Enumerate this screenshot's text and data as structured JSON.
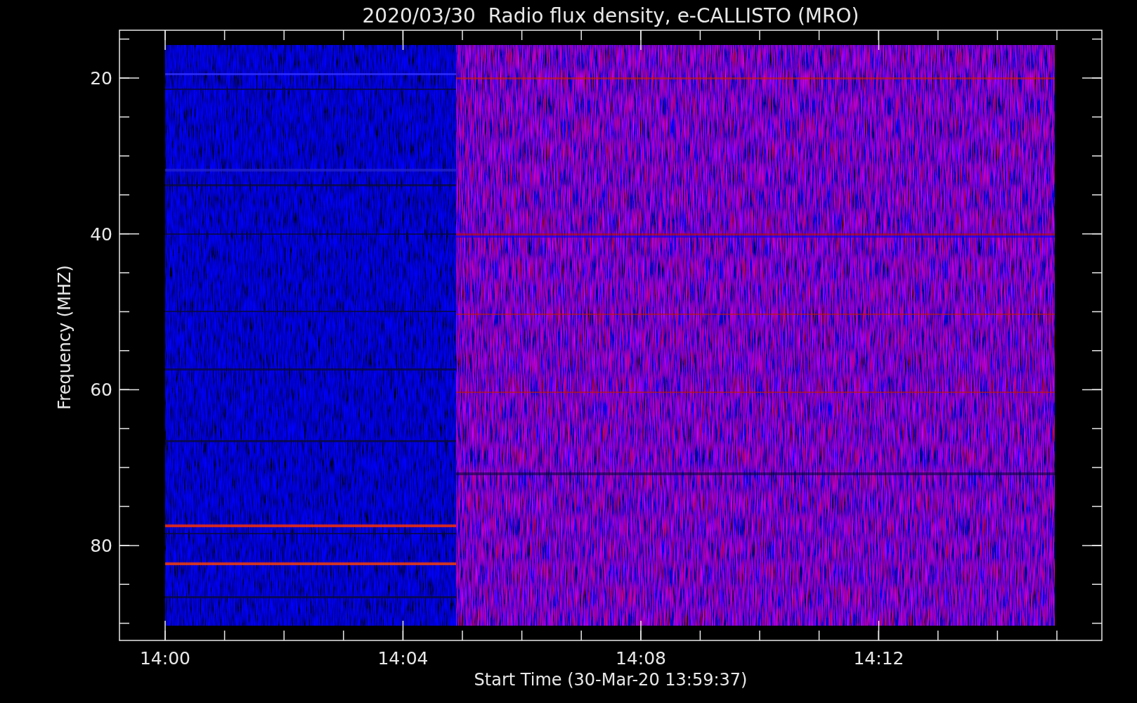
{
  "title": "2020/03/30  Radio flux density, e-CALLISTO (MRO)",
  "y_axis": {
    "label": "Frequency (MHZ)",
    "ticks": [
      "20",
      "40",
      "60",
      "80"
    ]
  },
  "x_axis": {
    "label": "Start Time (30-Mar-20 13:59:37)",
    "ticks": [
      "14:00",
      "14:04",
      "14:08",
      "14:12"
    ]
  }
}
